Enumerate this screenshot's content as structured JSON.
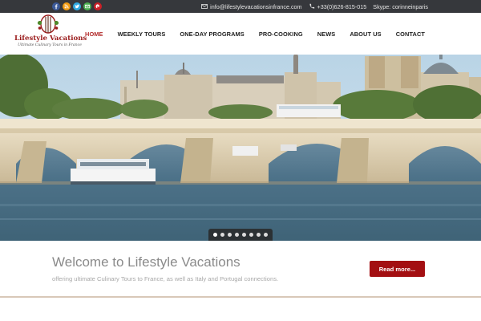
{
  "topbar": {
    "social_icons": [
      "facebook-icon",
      "rss-icon",
      "twitter-icon",
      "email-icon",
      "pinterest-icon"
    ],
    "email": "info@lifestylevacationsinfrance.com",
    "phone": "+33(0)626-815-015",
    "skype": "Skype: corinneinparis"
  },
  "logo": {
    "name": "Lifestyle Vacations",
    "tagline": "Ultimate Culinary Tours in France"
  },
  "nav": {
    "items": [
      "HOME",
      "WEEKLY TOURS",
      "ONE-DAY PROGRAMS",
      "PRO-COOKING",
      "NEWS",
      "ABOUT US",
      "CONTACT"
    ],
    "active": "HOME"
  },
  "slider": {
    "slide_count": 8,
    "active_slide": 1
  },
  "welcome": {
    "title": "Welcome to Lifestyle Vacations",
    "subtitle": "offering ultimate Culinary Tours to France, as well as Italy and Portugal connections.",
    "button": "Read more..."
  },
  "colors": {
    "topbar": "#36383c",
    "accent": "#b22a2a",
    "button": "#a30f12"
  }
}
